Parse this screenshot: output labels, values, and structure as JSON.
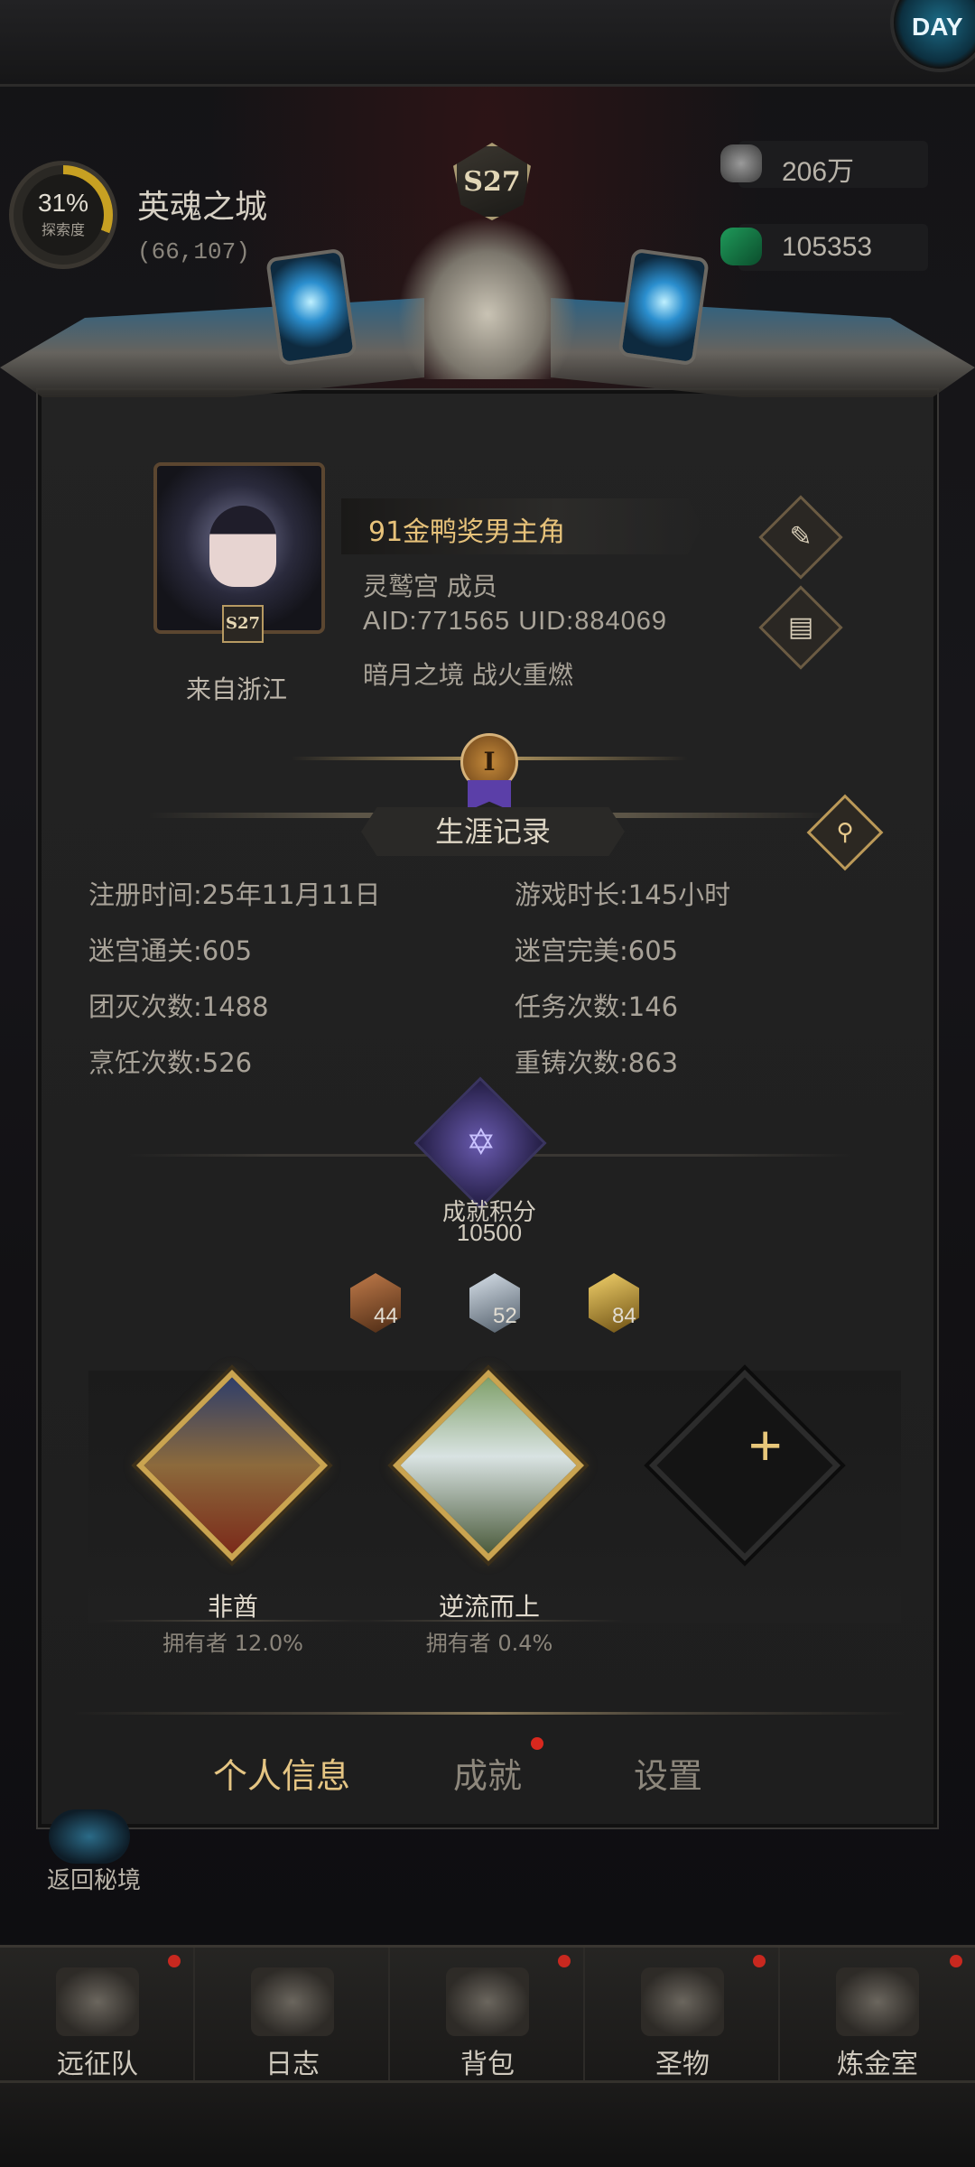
{
  "corner": {
    "label": "DAY"
  },
  "location": {
    "explore_percent": "31%",
    "explore_label": "探索度",
    "area_name": "英魂之城",
    "coords": "(66,107)"
  },
  "resources": [
    {
      "icon": "stone-icon",
      "value": "206万"
    },
    {
      "icon": "emerald-icon",
      "value": "105353"
    }
  ],
  "season": "S27",
  "profile": {
    "avatar_season": "S27",
    "origin": "来自浙江",
    "name": "91金鸭奖男主角",
    "guild": "灵鹫宫  成员",
    "ids": "AID:771565 UID:884069",
    "title": "暗月之境  战火重燃",
    "rank_numeral": "I"
  },
  "career": {
    "title": "生涯记录",
    "stats": [
      {
        "label": "注册时间:25年11月11日"
      },
      {
        "label": "游戏时长:145小时"
      },
      {
        "label": "迷宫通关:605"
      },
      {
        "label": "迷宫完美:605"
      },
      {
        "label": "团灭次数:1488"
      },
      {
        "label": "任务次数:146"
      },
      {
        "label": "烹饪次数:526"
      },
      {
        "label": "重铸次数:863"
      }
    ]
  },
  "achievement": {
    "label": "成就积分",
    "score": "10500",
    "medals": [
      {
        "tier": "bronze",
        "count": "44"
      },
      {
        "tier": "silver",
        "count": "52"
      },
      {
        "tier": "gold",
        "count": "84"
      }
    ],
    "badges": [
      {
        "name": "非酋",
        "owner": "拥有者 12.0%"
      },
      {
        "name": "逆流而上",
        "owner": "拥有者 0.4%"
      }
    ],
    "add_symbol": "+"
  },
  "tabs": [
    {
      "label": "个人信息",
      "active": true
    },
    {
      "label": "成就",
      "active": false,
      "badge": true
    },
    {
      "label": "设置",
      "active": false
    }
  ],
  "return_label": "返回秘境",
  "bottom_nav": [
    {
      "label": "远征队",
      "icon": "helmet-icon"
    },
    {
      "label": "日志",
      "icon": "scroll-icon"
    },
    {
      "label": "背包",
      "icon": "backpack-icon"
    },
    {
      "label": "圣物",
      "icon": "chalice-icon"
    },
    {
      "label": "炼金室",
      "icon": "alchemy-icon"
    }
  ],
  "colors": {
    "accent_gold": "#e5c583",
    "notification_red": "#d9281e"
  }
}
